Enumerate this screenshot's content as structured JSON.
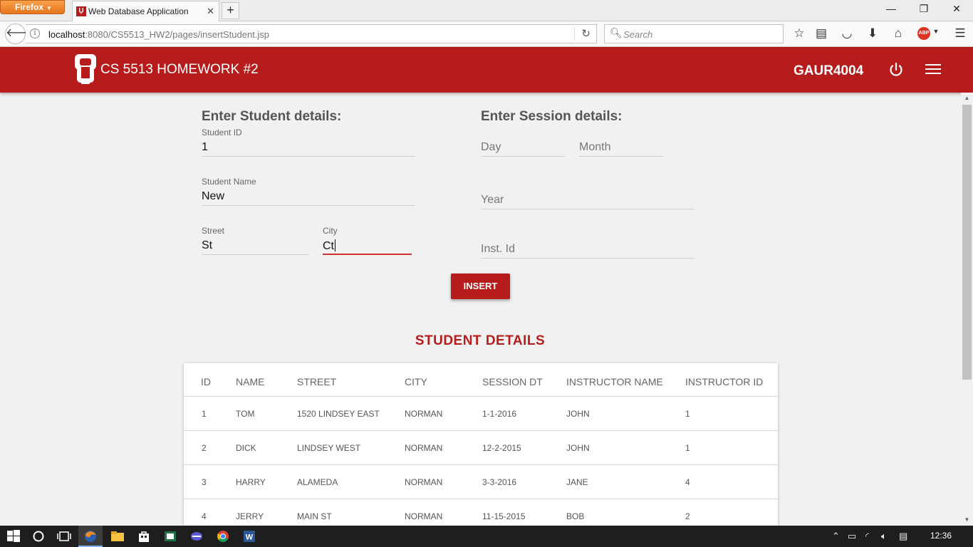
{
  "browser": {
    "menu_label": "Firefox",
    "tab_title": "Web Database Application",
    "url_host": "localhost",
    "url_path": ":8080/CS5513_HW2/pages/insertStudent.jsp",
    "search_placeholder": "Search"
  },
  "header": {
    "title": "CS 5513 HOMEWORK #2",
    "user": "GAUR4004",
    "brand_color": "#b71c1c"
  },
  "student_form": {
    "title": "Enter Student details:",
    "id_label": "Student ID",
    "id_value": "1",
    "name_label": "Student Name",
    "name_value": "New",
    "street_label": "Street",
    "street_value": "St",
    "city_label": "City",
    "city_value": "Ct"
  },
  "session_form": {
    "title": "Enter Session details:",
    "day_placeholder": "Day",
    "month_placeholder": "Month",
    "year_placeholder": "Year",
    "inst_placeholder": "Inst. Id"
  },
  "insert_label": "INSERT",
  "table": {
    "title": "STUDENT DETAILS",
    "headers": [
      "ID",
      "NAME",
      "STREET",
      "CITY",
      "SESSION DT",
      "INSTRUCTOR NAME",
      "INSTRUCTOR ID"
    ],
    "rows": [
      [
        "1",
        "TOM",
        "1520 LINDSEY EAST",
        "NORMAN",
        "1-1-2016",
        "JOHN",
        "1"
      ],
      [
        "2",
        "DICK",
        "LINDSEY WEST",
        "NORMAN",
        "12-2-2015",
        "JOHN",
        "1"
      ],
      [
        "3",
        "HARRY",
        "ALAMEDA",
        "NORMAN",
        "3-3-2016",
        "JANE",
        "4"
      ],
      [
        "4",
        "JERRY",
        "MAIN ST",
        "NORMAN",
        "11-15-2015",
        "BOB",
        "2"
      ]
    ]
  },
  "taskbar": {
    "clock": "12:36"
  }
}
